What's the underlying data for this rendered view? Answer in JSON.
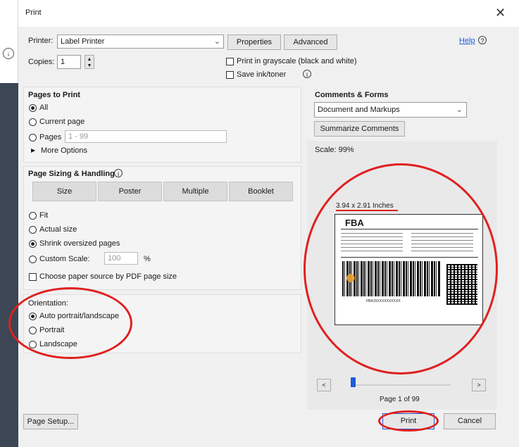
{
  "window": {
    "title": "Print",
    "close_icon": "close-icon"
  },
  "left_strip": {
    "icon": "download-icon",
    "glyph": "↓"
  },
  "printer": {
    "label": "Printer:",
    "value": "Label Printer",
    "properties_label": "Properties",
    "advanced_label": "Advanced",
    "help_label": "Help",
    "help_glyph": "?"
  },
  "copies": {
    "label": "Copies:",
    "value": "1"
  },
  "grayscale": {
    "label": "Print in grayscale (black and white)",
    "checked": false
  },
  "save_ink": {
    "label": "Save ink/toner",
    "checked": false,
    "info_glyph": "i"
  },
  "pages_to_print": {
    "heading": "Pages to Print",
    "all_label": "All",
    "current_label": "Current page",
    "pages_label": "Pages",
    "pages_value": "1 - 99",
    "more_options_label": "More Options",
    "selected": "All"
  },
  "sizing": {
    "heading": "Page Sizing & Handling",
    "info_glyph": "i",
    "buttons": [
      "Size",
      "Poster",
      "Multiple",
      "Booklet"
    ],
    "fit_label": "Fit",
    "actual_label": "Actual size",
    "shrink_label": "Shrink oversized pages",
    "custom_label": "Custom Scale:",
    "custom_value": "100",
    "custom_unit": "%",
    "paper_source_label": "Choose paper source by PDF page size",
    "selected": "Shrink oversized pages"
  },
  "orientation": {
    "heading": "Orientation:",
    "auto_label": "Auto portrait/landscape",
    "portrait_label": "Portrait",
    "landscape_label": "Landscape",
    "selected": "Auto portrait/landscape"
  },
  "comments": {
    "heading": "Comments & Forms",
    "value": "Document and Markups",
    "summarize_label": "Summarize Comments"
  },
  "preview": {
    "scale": "Scale: 99%",
    "size": "3.94 x 2.91 Inches",
    "label_title": "FBA",
    "barcode_text": "FBA15XXXXXXXXXX",
    "page_info": "Page 1 of 99",
    "slider_fraction": 0.0,
    "prev_glyph": "<",
    "next_glyph": ">"
  },
  "footer": {
    "page_setup_label": "Page Setup...",
    "print_label": "Print",
    "cancel_label": "Cancel"
  },
  "colors": {
    "highlight": "#e02020",
    "accent": "#1e5bd6",
    "dialog_bg": "#f0f0f0"
  }
}
